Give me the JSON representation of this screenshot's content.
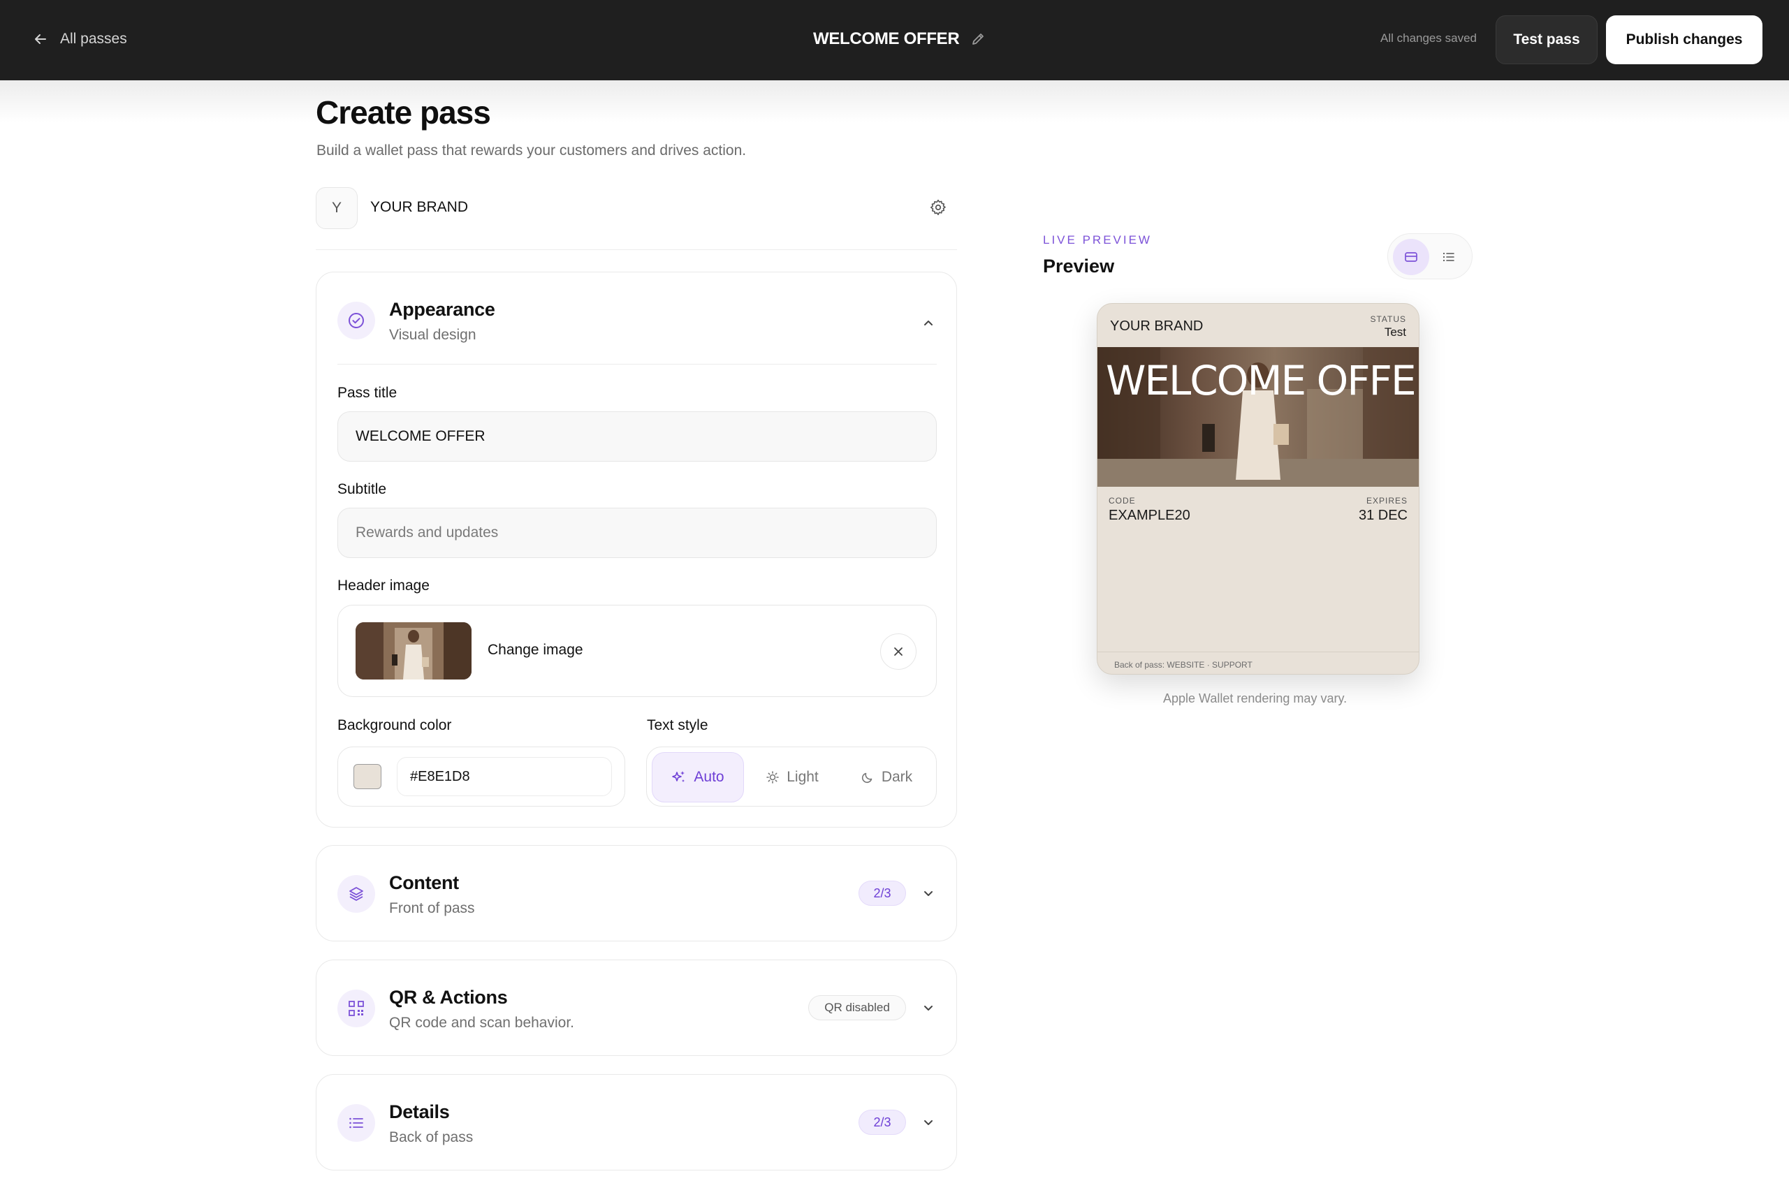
{
  "topbar": {
    "back_label": "All passes",
    "title": "WELCOME OFFER",
    "saved_status": "All changes saved",
    "test_label": "Test pass",
    "publish_label": "Publish changes"
  },
  "page": {
    "title": "Create pass",
    "subtitle": "Build a wallet pass that rewards your customers and drives action."
  },
  "brand": {
    "initial": "Y",
    "name": "YOUR BRAND"
  },
  "appearance": {
    "title": "Appearance",
    "subtitle": "Visual design",
    "pass_title_label": "Pass title",
    "pass_title_value": "WELCOME OFFER",
    "subtitle_label": "Subtitle",
    "subtitle_placeholder": "Rewards and updates",
    "header_image_label": "Header image",
    "change_image_label": "Change image",
    "background_color_label": "Background color",
    "background_color_value": "#E8E1D8",
    "text_style_label": "Text style",
    "text_style_options": [
      "Auto",
      "Light",
      "Dark"
    ],
    "text_style_selected": "Auto"
  },
  "content": {
    "title": "Content",
    "subtitle": "Front of pass",
    "badge": "2/3"
  },
  "qr": {
    "title": "QR & Actions",
    "subtitle": "QR code and scan behavior.",
    "badge": "QR disabled"
  },
  "details": {
    "title": "Details",
    "subtitle": "Back of pass",
    "badge": "2/3"
  },
  "preview": {
    "eyebrow": "LIVE PREVIEW",
    "title": "Preview",
    "note": "Apple Wallet rendering may vary.",
    "pass": {
      "brand": "YOUR BRAND",
      "status_label": "STATUS",
      "status_value": "Test",
      "hero_title": "WELCOME OFFER",
      "code_label": "CODE",
      "code_value": "EXAMPLE20",
      "expires_label": "EXPIRES",
      "expires_value": "31 DEC",
      "back_text": "Back of pass: WEBSITE · SUPPORT"
    }
  },
  "colors": {
    "accent": "#7C52D8",
    "topbar": "#1F1F1F",
    "pass_background": "#E8E1D8"
  },
  "icons": {
    "back": "arrow-left-icon",
    "edit": "pencil-icon",
    "settings": "gear-icon",
    "appearance": "badge-check-icon",
    "content": "layers-icon",
    "qr": "qr-code-icon",
    "details": "list-icon",
    "close": "close-icon",
    "chevron": "chevron-icon",
    "auto": "sparkles-icon",
    "light": "sun-icon",
    "dark": "moon-icon",
    "card_view": "card-icon",
    "list_view": "list-icon"
  }
}
